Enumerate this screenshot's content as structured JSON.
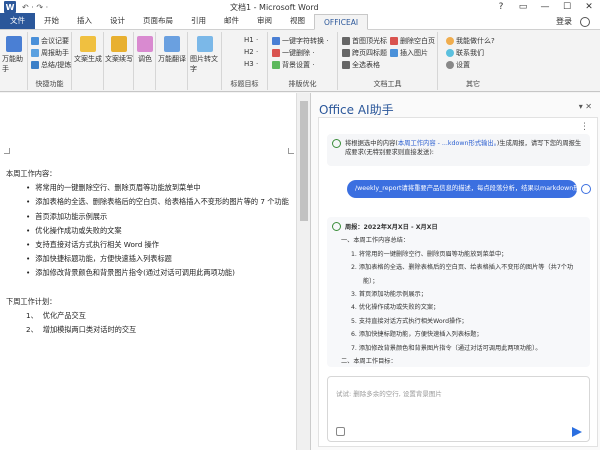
{
  "window": {
    "title": "文档1 - Microsoft Word",
    "logo": "W",
    "quick_access": "↶ · ↷ ·",
    "controls": [
      "?",
      "▭",
      "—",
      "☐",
      "✕"
    ],
    "login": "登录"
  },
  "tabs": [
    "文件",
    "开始",
    "插入",
    "设计",
    "页面布局",
    "引用",
    "邮件",
    "审阅",
    "视图",
    "OFFICEAI"
  ],
  "ribbon": {
    "assistant": {
      "label": "万能助手",
      "group": ""
    },
    "shortcut": {
      "items": [
        "会议记要",
        "周报助手",
        "总结/提炼"
      ],
      "group": "快捷功能"
    },
    "doc_gen": {
      "label": "文案生成"
    },
    "doc_rewrite": {
      "label": "文案续写"
    },
    "adjust": {
      "label": "调色"
    },
    "formula": {
      "label": "万能翻译",
      "group": "万能翻译"
    },
    "image": {
      "label": "图片转文字"
    },
    "headings": {
      "items": [
        "H1 ·",
        "H2 ·",
        "H3 ·"
      ],
      "group": "标题目标"
    },
    "format": {
      "items": [
        "一键字符转换 ·",
        "一键删除 ·",
        "背景设置 ·"
      ],
      "group": "排版优化"
    },
    "tools": {
      "items": [
        "首图顶光标",
        "删除空白页",
        "跨页四标题",
        "插入图片",
        "全选表格"
      ],
      "group": "文档工具"
    },
    "other": {
      "items": [
        "我能做什么?",
        "联系我们",
        "设置"
      ],
      "group": "其它"
    }
  },
  "document": {
    "lines": [
      {
        "text": "本周工作内容：",
        "indent": 0,
        "bullet": ""
      },
      {
        "text": "将常用的一键删除空行、删除页眉等功能放到菜单中",
        "indent": 1,
        "bullet": "•"
      },
      {
        "text": "添加表格的全选、删除表格后的空白页、给表格插入不变形的图片等的 7 个功能",
        "indent": 1,
        "bullet": "•"
      },
      {
        "text": "首页添加功能示例展示",
        "indent": 1,
        "bullet": "•"
      },
      {
        "text": "优化操作成功或失败的文案",
        "indent": 1,
        "bullet": "•"
      },
      {
        "text": "支持直接对话方式执行相关 Word 操作",
        "indent": 1,
        "bullet": "•"
      },
      {
        "text": "添加快捷标题功能，方便快速插入列表标题",
        "indent": 1,
        "bullet": "•"
      },
      {
        "text": "添加修改背景颜色和背景图片指令(通过对话可调用此两项功能)",
        "indent": 1,
        "bullet": "•"
      },
      {
        "text": "",
        "indent": 0,
        "bullet": ""
      },
      {
        "text": "下周工作计划：",
        "indent": 0,
        "bullet": ""
      },
      {
        "text": "优化产品交互",
        "indent": 1,
        "bullet": "1、"
      },
      {
        "text": "增加模拟两口类对话时的交互",
        "indent": 1,
        "bullet": "2、"
      }
    ]
  },
  "ai_panel": {
    "title": "Office AI助手",
    "controls": "▾ ✕",
    "more": "⋮",
    "prompt_pre": "将根据选中的内容(",
    "prompt_hl": "本周工作内容 - ...kdown形式输出。",
    "prompt_post": ")生成周报，请写下您的周报生成要求(无特别要求则直接发送):",
    "user_msg": "/weekly_report请将重要产品信息的描述，每点段落分析，结果以markdown形式输出。",
    "response": [
      {
        "text": "周报：2022年X月X日 - X月X日",
        "indent": 0
      },
      {
        "text": "一、本周工作内容总结：",
        "indent": 1
      },
      {
        "text": "1.    将常用的一键删除空行、删除页眉等功能放到菜单中；",
        "indent": 2
      },
      {
        "text": "2.    添加表格的全选、删除表格后的空白页、给表格插入不变形的图片等（共7个功",
        "indent": 2
      },
      {
        "text": "能）；",
        "indent": 3
      },
      {
        "text": "3.    首页添加功能示例展示；",
        "indent": 2
      },
      {
        "text": "4.    优化操作成功或失败的文案；",
        "indent": 2
      },
      {
        "text": "5.    支持直接对话方式执行相关Word操作；",
        "indent": 2
      },
      {
        "text": "6.    添加快捷标题功能，方便快速插入列表标题；",
        "indent": 2
      },
      {
        "text": "7.    添加修改背景颜色和背景图片指令（通过对话可调用此两项功能）。",
        "indent": 2
      },
      {
        "text": "二、本周工作目标：",
        "indent": 1
      }
    ],
    "input_placeholder": "试试: 删除多余的空行, 设置背景图片"
  },
  "colors": {
    "brand": "#2b579a",
    "accent": "#3b6fe0",
    "ok": "#3a8d3a"
  }
}
